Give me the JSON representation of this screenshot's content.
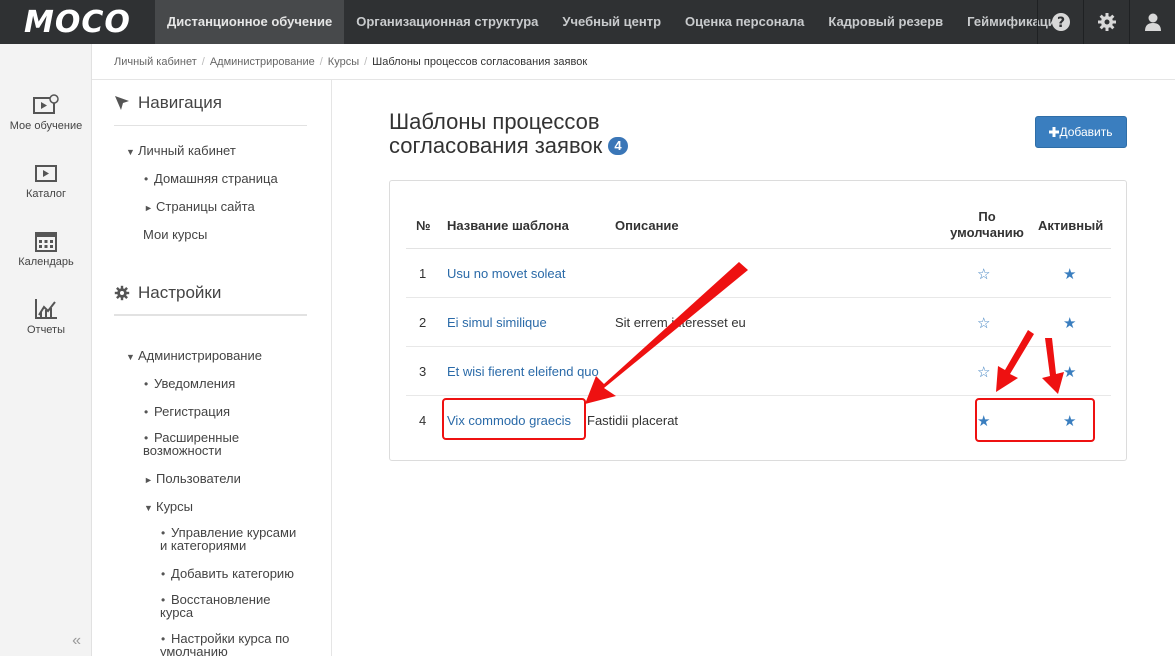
{
  "topbar": {
    "logo": "MOCO",
    "nav": [
      "Дистанционное обучение",
      "Организационная структура",
      "Учебный центр",
      "Оценка персонала",
      "Кадровый резерв",
      "Геймификация"
    ],
    "active_index": 0
  },
  "rail": {
    "items": [
      {
        "label": "Мое обучение",
        "icon": "my-learning-icon"
      },
      {
        "label": "Каталог",
        "icon": "catalog-icon"
      },
      {
        "label": "Календарь",
        "icon": "calendar-icon"
      },
      {
        "label": "Отчеты",
        "icon": "reports-icon"
      }
    ],
    "collapse": "«"
  },
  "breadcrumb": {
    "items": [
      "Личный кабинет",
      "Администрирование",
      "Курсы"
    ],
    "separator": "/",
    "current": "Шаблоны процессов согласования заявок"
  },
  "nav": {
    "nav_title": "Навигация",
    "personal": "Личный кабинет",
    "home": "Домашняя страница",
    "site_pages": "Страницы сайта",
    "my_courses": "Мои курсы",
    "settings_title": "Настройки",
    "admin": "Администрирование",
    "notifications": "Уведомления",
    "registration": "Регистрация",
    "advanced_1": "Расширенные",
    "advanced_2": "возможности",
    "users": "Пользователи",
    "courses": "Курсы",
    "manage_1": "Управление курсами",
    "manage_2": "и категориями",
    "add_category": "Добавить категорию",
    "restore_1": "Восстановление",
    "restore_2": "курса",
    "defaults_1": "Настройки курса по",
    "defaults_2": "умолчанию"
  },
  "main": {
    "title_line1": "Шаблоны процессов",
    "title_line2": "согласования заявок",
    "count": "4",
    "add_button": "Добавить"
  },
  "table": {
    "headers": {
      "num": "№",
      "name": "Название шаблона",
      "desc": "Описание",
      "default_1": "По",
      "default_2": "умолчанию",
      "active": "Активный"
    },
    "rows": [
      {
        "num": "1",
        "name": "Usu no movet soleat",
        "desc": "",
        "default_filled": false,
        "active_filled": true
      },
      {
        "num": "2",
        "name": "Ei simul similique",
        "desc": "Sit errem interesset eu",
        "default_filled": false,
        "active_filled": true
      },
      {
        "num": "3",
        "name": "Et wisi fierent eleifend quo",
        "desc": "",
        "default_filled": false,
        "active_filled": true
      },
      {
        "num": "4",
        "name": "Vix commodo graecis",
        "desc": "Fastidii placerat",
        "default_filled": true,
        "active_filled": true
      }
    ],
    "star_filled": "★",
    "star_empty": "☆"
  },
  "colors": {
    "topbar": "#2f3133",
    "link": "#2a6aa8",
    "accent": "#3a7ebf",
    "annotation": "#ee1111"
  }
}
